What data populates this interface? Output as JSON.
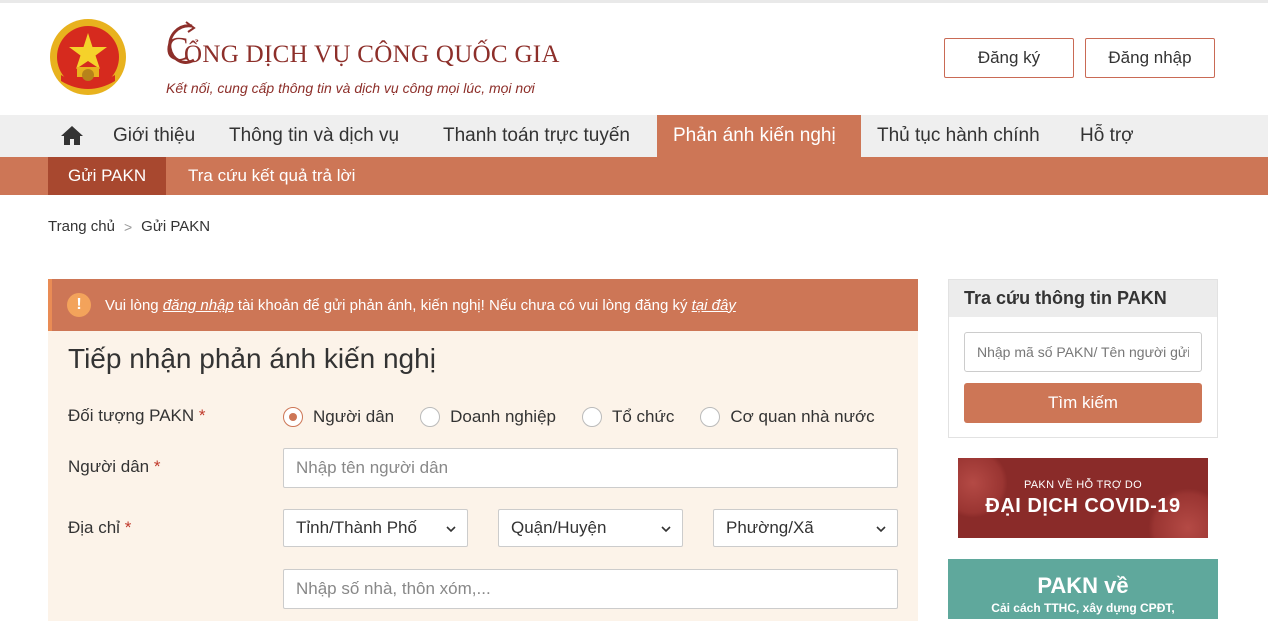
{
  "header": {
    "title_initial": "C",
    "title_rest": "ỔNG DỊCH VỤ CÔNG QUỐC GIA",
    "subtitle": "Kết nối, cung cấp thông tin và dịch vụ công mọi lúc, mọi nơi",
    "register_label": "Đăng ký",
    "login_label": "Đăng nhập",
    "emblem_icon": "national-emblem-icon",
    "accent_color": "#8d2f2a"
  },
  "main_nav": {
    "home_icon": "home-icon",
    "items": [
      {
        "label": "Giới thiệu"
      },
      {
        "label": "Thông tin và dịch vụ"
      },
      {
        "label": "Thanh toán trực tuyến"
      },
      {
        "label": "Phản ánh kiến nghị",
        "active": true
      },
      {
        "label": "Thủ tục hành chính"
      },
      {
        "label": "Hỗ trợ"
      }
    ],
    "active_color": "#cd7656"
  },
  "sub_nav": {
    "items": [
      {
        "label": "Gửi PAKN",
        "active": true
      },
      {
        "label": "Tra cứu kết quả trả lời"
      }
    ]
  },
  "breadcrumb": {
    "home": "Trang chủ",
    "separator": ">",
    "current": "Gửi PAKN"
  },
  "alert": {
    "icon": "!",
    "text_before": "Vui lòng ",
    "link_login": "đăng nhập",
    "text_middle": " tài khoản để gửi phản ánh, kiến nghị! Nếu chưa có vui lòng đăng ký ",
    "link_here": "tại đây"
  },
  "form": {
    "title": "Tiếp nhận phản ánh kiến nghị",
    "required_mark": "*",
    "subject_label": "Đối tượng PAKN",
    "subject_options": [
      {
        "label": "Người dân",
        "selected": true
      },
      {
        "label": "Doanh nghiệp"
      },
      {
        "label": "Tổ chức"
      },
      {
        "label": "Cơ quan nhà nước"
      }
    ],
    "name_label": "Người dân",
    "name_placeholder": "Nhập tên người dân",
    "address_label": "Địa chỉ",
    "province_value": "Tỉnh/Thành Phố",
    "district_value": "Quận/Huyện",
    "ward_value": "Phường/Xã",
    "street_placeholder": "Nhập số nhà, thôn xóm,..."
  },
  "sidebar": {
    "lookup_title": "Tra cứu thông tin PAKN",
    "lookup_placeholder": "Nhập mã số PAKN/ Tên người gửi",
    "lookup_button": "Tìm kiếm",
    "covid_banner_small": "PAKN VỀ HỖ TRỢ DO",
    "covid_banner_big": "ĐẠI DỊCH COVID-19",
    "pakn_banner_big": "PAKN về",
    "pakn_banner_small": "Cải cách TTHC, xây dựng CPĐT,"
  }
}
